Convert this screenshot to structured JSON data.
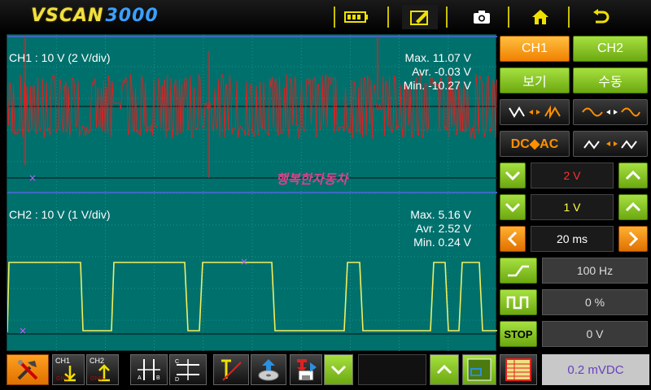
{
  "app": {
    "brand": "VSCAN",
    "model": "3000"
  },
  "topbar": {
    "battery_icon": "battery-icon",
    "edit_icon": "pencil-icon",
    "camera_icon": "camera-icon",
    "home_icon": "home-icon",
    "back_icon": "back-arrow-icon"
  },
  "ch1": {
    "label": "CH1 : 10 V (2 V/div)",
    "max": "Max. 11.07 V",
    "avr": "Avr. -0.03 V",
    "min": "Min. -10.27 V",
    "color": "#e02020"
  },
  "ch2": {
    "label": "CH2 : 10 V (1 V/div)",
    "max": "Max.  5.16 V",
    "avr": "Avr.  2.52 V",
    "min": "Min.  0.24 V",
    "color": "#f0f060"
  },
  "watermark": "행복한자동차",
  "right_panel": {
    "ch1_btn": "CH1",
    "ch2_btn": "CH2",
    "view_btn": "보기",
    "manual_btn": "수동",
    "dc_ac": "DC◆AC",
    "ch1_volt": "2 V",
    "ch2_volt": "1 V",
    "time": "20 ms",
    "freq": "100 Hz",
    "duty": "0 %",
    "stop_btn": "STOP",
    "stop_val": "0 V",
    "ch1_volt_color": "#ff3030",
    "ch2_volt_color": "#ffff40"
  },
  "bottom": {
    "ch1_label": "CH1",
    "ch2_label": "CH2",
    "reading": "0.2 mVDC"
  }
}
